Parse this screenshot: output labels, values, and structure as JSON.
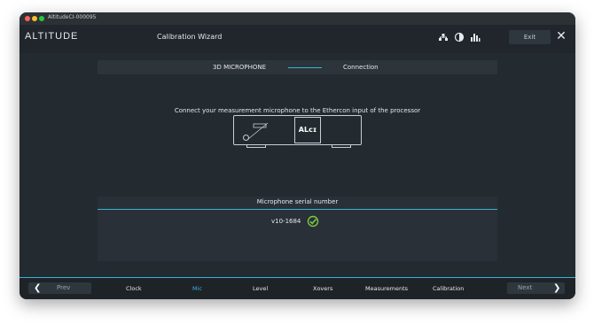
{
  "window": {
    "title": "AltitudeCI-000095"
  },
  "header": {
    "logo": "ALTITUDE",
    "title": "Calibration Wizard",
    "icons": [
      "network-icon",
      "contrast-icon",
      "equalizer-icon"
    ],
    "exit_label": "Exit"
  },
  "steps": {
    "step1": "3D MICROPHONE",
    "step2": "Connection"
  },
  "instruction": "Connect your measurement microphone to the Ethercon input of the processor",
  "device": {
    "logo": "ALᴄɪ"
  },
  "serial": {
    "title": "Microphone serial number",
    "value": "v10-1684"
  },
  "footer": {
    "prev_label": "Prev",
    "next_label": "Next",
    "nav": [
      "Clock",
      "Mic",
      "Level",
      "Xovers",
      "Measurements",
      "Calibration"
    ],
    "active": "Mic"
  },
  "colors": {
    "accent": "#3ab3d6",
    "check": "#7ac943",
    "background": "#232a30"
  }
}
